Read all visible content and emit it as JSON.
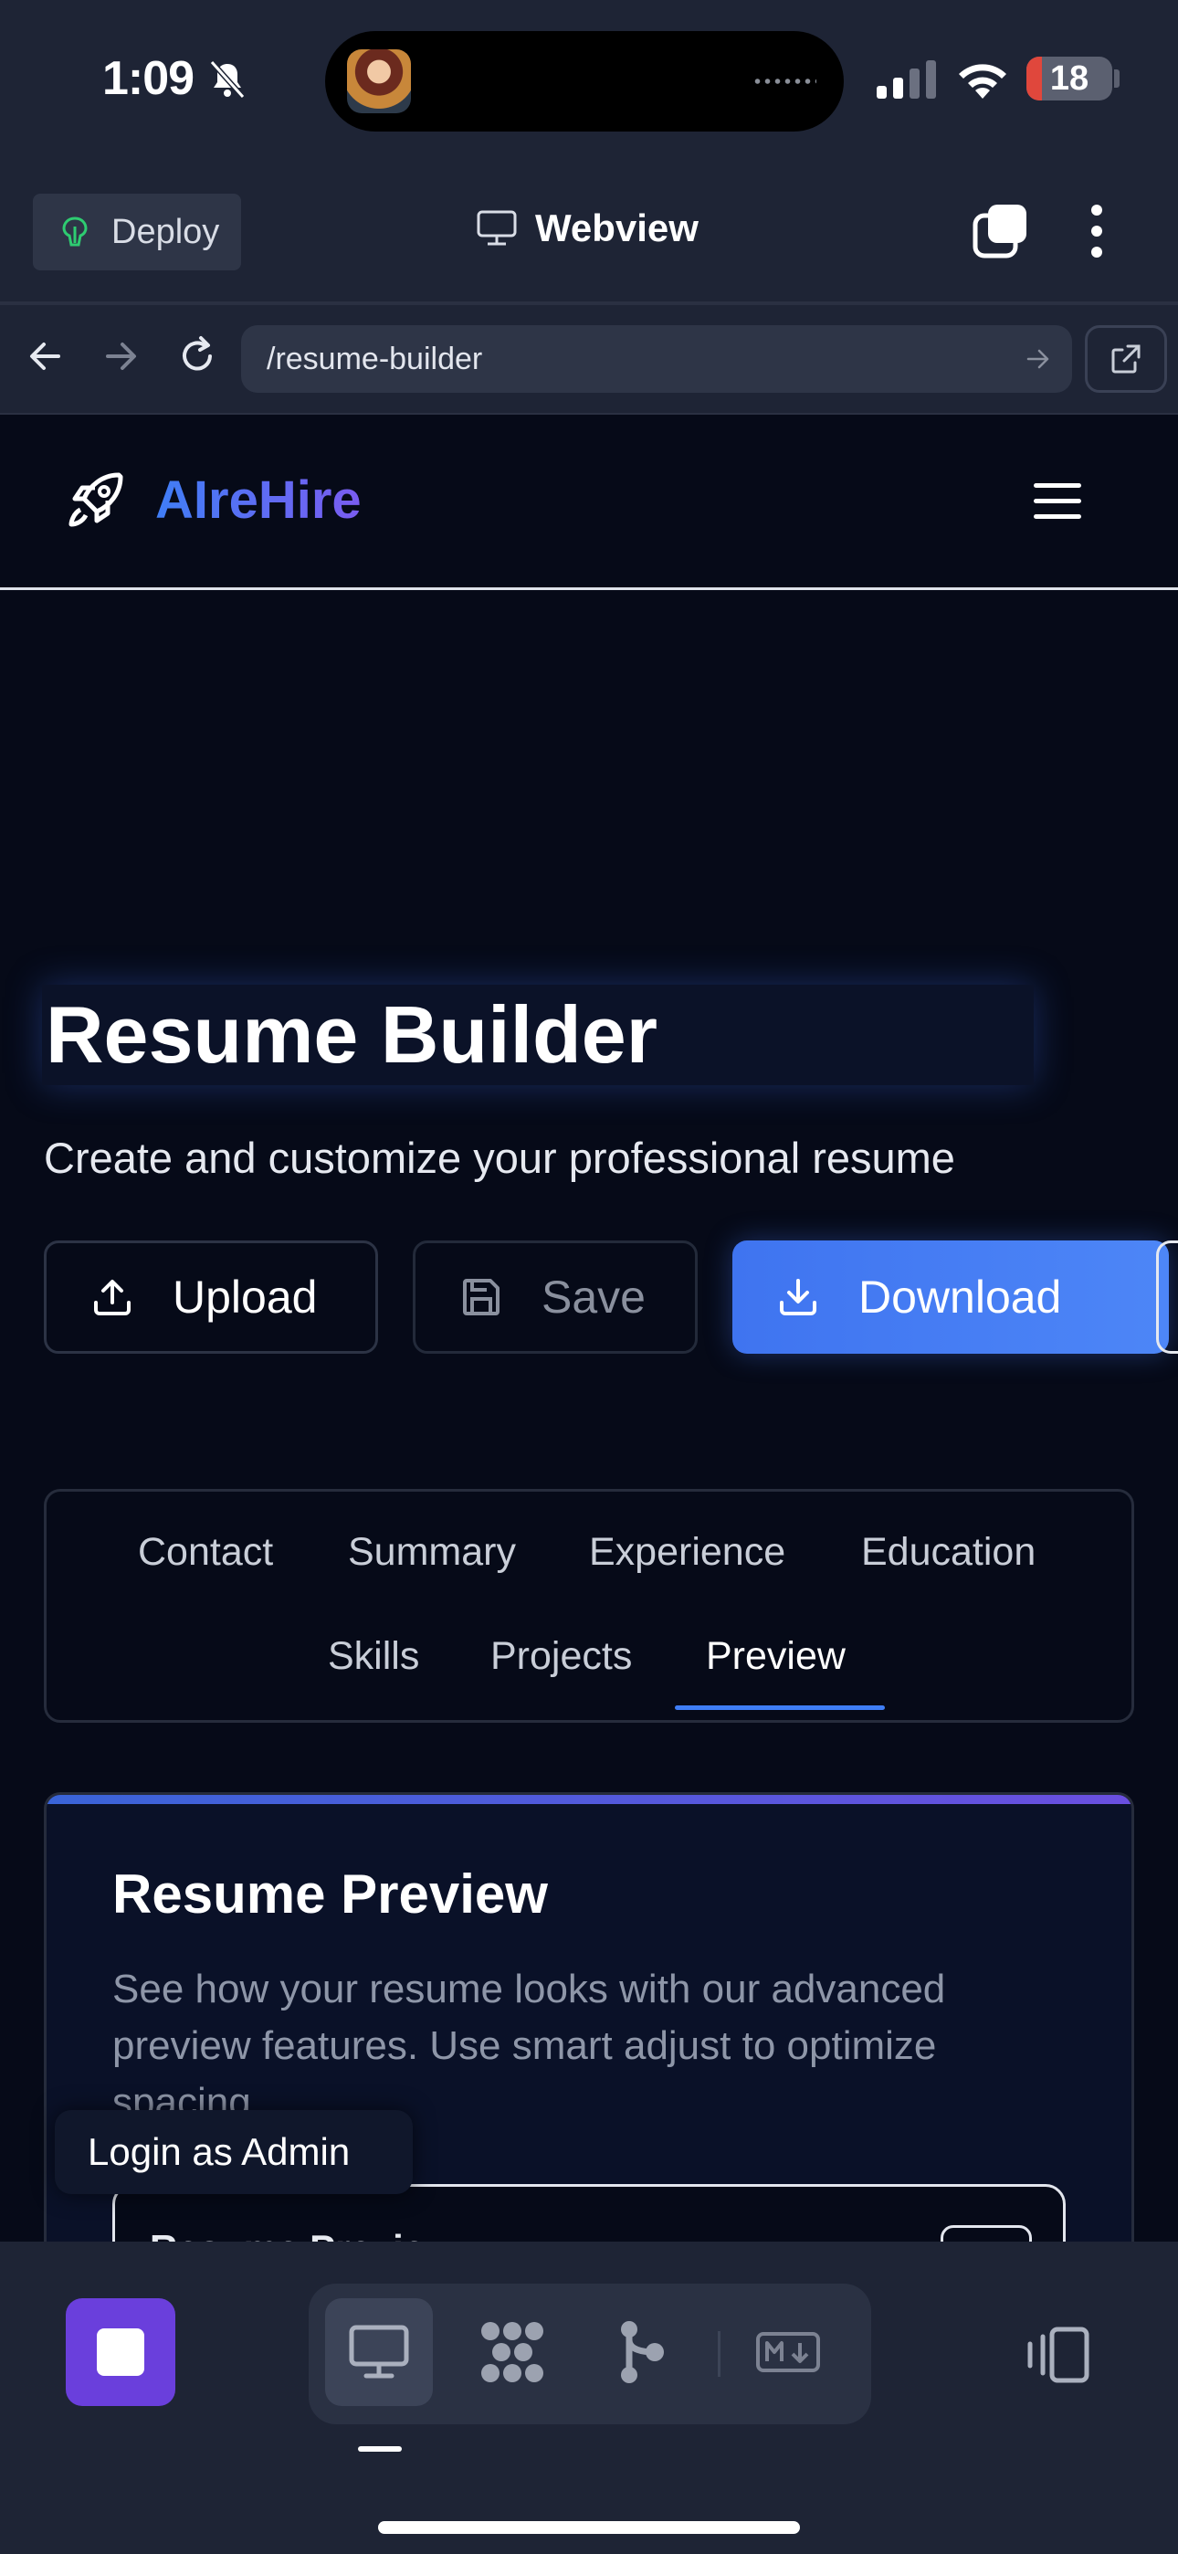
{
  "status_bar": {
    "time": "1:09",
    "battery": "18",
    "battery_level": 0.18
  },
  "toolbar": {
    "deploy_label": "Deploy",
    "title": "Webview"
  },
  "url_bar": {
    "url": "/resume-builder"
  },
  "site": {
    "brand": "AIreHire",
    "brand_colors": [
      "#3f7ef6",
      "#7a5cf0"
    ]
  },
  "hero": {
    "title": "Resume Builder",
    "subtitle": "Create and customize your professional resume"
  },
  "actions": {
    "upload": "Upload",
    "save": "Save",
    "download": "Download"
  },
  "tabs": [
    {
      "label": "Contact",
      "active": false
    },
    {
      "label": "Summary",
      "active": false
    },
    {
      "label": "Experience",
      "active": false
    },
    {
      "label": "Education",
      "active": false
    },
    {
      "label": "Skills",
      "active": false
    },
    {
      "label": "Projects",
      "active": false
    },
    {
      "label": "Preview",
      "active": true
    }
  ],
  "preview": {
    "title": "Resume Preview",
    "description": "See how your resume looks with our advanced preview features. Use smart adjust to optimize spacing.",
    "inner_title": "Resume Preview"
  },
  "admin": {
    "label": "Login as Admin"
  },
  "bottom_bar": {
    "tools": [
      "monitor-icon",
      "grid-icon",
      "branch-icon",
      "markdown-icon"
    ],
    "accent": "#6a3fdc"
  }
}
